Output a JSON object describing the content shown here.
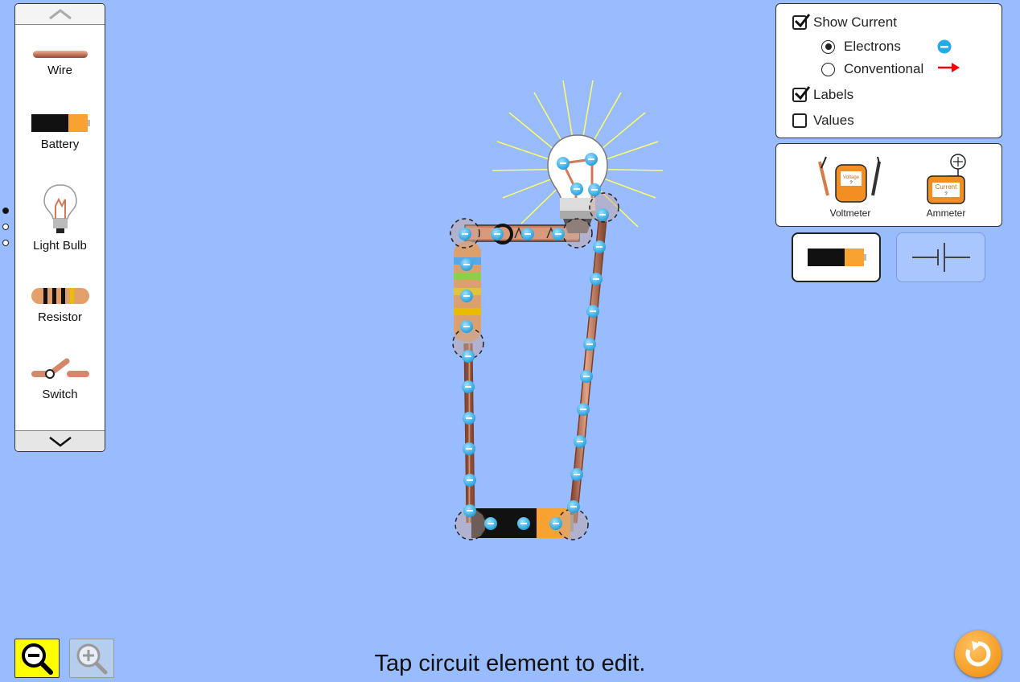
{
  "toolbox": {
    "items": [
      {
        "label": "Wire",
        "icon": "wire-icon"
      },
      {
        "label": "Battery",
        "icon": "battery-icon"
      },
      {
        "label": "Light Bulb",
        "icon": "light-bulb-icon"
      },
      {
        "label": "Resistor",
        "icon": "resistor-icon"
      },
      {
        "label": "Switch",
        "icon": "switch-icon"
      }
    ],
    "scroll_up_icon": "chevron-up-icon",
    "scroll_down_icon": "chevron-down-icon",
    "page_count": 3,
    "active_page": 1
  },
  "controls": {
    "show_current": {
      "label": "Show Current",
      "checked": true
    },
    "electrons": {
      "label": "Electrons",
      "selected": true,
      "icon": "electron-icon"
    },
    "conventional": {
      "label": "Conventional",
      "selected": false,
      "icon": "red-arrow-icon"
    },
    "labels": {
      "label": "Labels",
      "checked": true
    },
    "values": {
      "label": "Values",
      "checked": false
    }
  },
  "meters": {
    "voltmeter": {
      "label": "Voltmeter",
      "screen_text": "Voltage",
      "reading": "?"
    },
    "ammeter": {
      "label": "Ammeter",
      "screen_text": "Current",
      "reading": "?"
    }
  },
  "view_toggle": {
    "lifelike": {
      "icon": "battery-icon",
      "selected": true
    },
    "schematic": {
      "icon": "schematic-battery-icon",
      "selected": false
    }
  },
  "zoom": {
    "zoom_out_icon": "zoom-out-icon",
    "zoom_in_icon": "zoom-in-icon",
    "zoom_out_active": true
  },
  "status": {
    "text": "Tap circuit element to edit."
  },
  "reset": {
    "icon": "reset-icon"
  },
  "colors": {
    "background": "#99bbff",
    "copper": "#c98a6c",
    "electron": "#3ab0e8",
    "current_arrow": "#ff0000",
    "bulb_rays": "#ffff66",
    "zoom_active": "#ffff00",
    "reset": "#f5a623"
  }
}
